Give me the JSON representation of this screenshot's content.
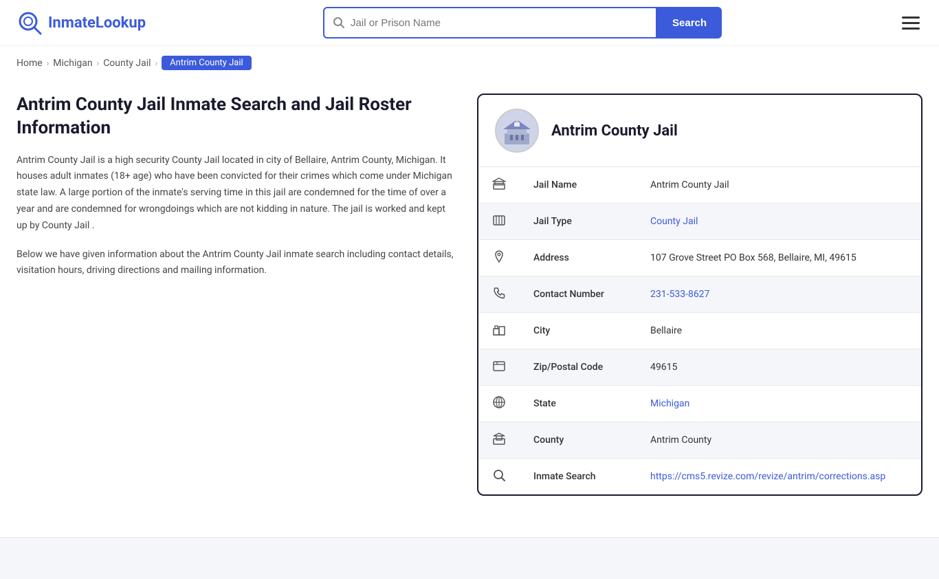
{
  "header": {
    "logo_text_part1": "Inmate",
    "logo_text_part2": "Lookup",
    "search_placeholder": "Jail or Prison Name",
    "search_button_label": "Search",
    "menu_label": "Menu"
  },
  "breadcrumb": {
    "home": "Home",
    "michigan": "Michigan",
    "county_jail": "County Jail",
    "active": "Antrim County Jail"
  },
  "page": {
    "title": "Antrim County Jail Inmate Search and Jail Roster Information",
    "description1": "Antrim County Jail is a high security County Jail located in city of Bellaire, Antrim County, Michigan. It houses adult inmates (18+ age) who have been convicted for their crimes which come under Michigan state law. A large portion of the inmate's serving time in this jail are condemned for the time of over a year and are condemned for wrongdoings which are not kidding in nature. The jail is worked and kept up by County Jail .",
    "description2": "Below we have given information about the Antrim County Jail inmate search including contact details, visitation hours, driving directions and mailing information."
  },
  "jail_card": {
    "title": "Antrim County Jail",
    "fields": [
      {
        "icon": "jail-icon",
        "label": "Jail Name",
        "value": "Antrim County Jail",
        "link": null
      },
      {
        "icon": "type-icon",
        "label": "Jail Type",
        "value": "County Jail",
        "link": "#"
      },
      {
        "icon": "address-icon",
        "label": "Address",
        "value": "107 Grove Street PO Box 568, Bellaire, MI, 49615",
        "link": null
      },
      {
        "icon": "phone-icon",
        "label": "Contact Number",
        "value": "231-533-8627",
        "link": "tel:231-533-8627"
      },
      {
        "icon": "city-icon",
        "label": "City",
        "value": "Bellaire",
        "link": null
      },
      {
        "icon": "zip-icon",
        "label": "Zip/Postal Code",
        "value": "49615",
        "link": null
      },
      {
        "icon": "state-icon",
        "label": "State",
        "value": "Michigan",
        "link": "#"
      },
      {
        "icon": "county-icon",
        "label": "County",
        "value": "Antrim County",
        "link": null
      },
      {
        "icon": "inmate-search-icon",
        "label": "Inmate Search",
        "value": "https://cms5.revize.com/revize/antrim/corrections.asp",
        "link": "https://cms5.revize.com/revize/antrim/corrections.asp"
      }
    ]
  }
}
